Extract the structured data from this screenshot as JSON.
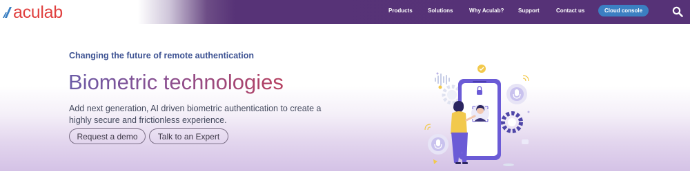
{
  "brand": {
    "name": "aculab",
    "color": "#e0403f"
  },
  "nav": {
    "items": [
      {
        "label": "Products"
      },
      {
        "label": "Solutions"
      },
      {
        "label": "Why Aculab?"
      },
      {
        "label": "Support"
      },
      {
        "label": "Contact us"
      }
    ],
    "cta_label": "Cloud console",
    "search_icon": "search-icon"
  },
  "hero": {
    "eyebrow": "Changing the future of remote authentication",
    "title": "Biometric technologies",
    "description": "Add next generation, AI driven biometric authentication to create a highly secure and frictionless experience.",
    "buttons": [
      {
        "label": "Request a demo"
      },
      {
        "label": "Talk to an Expert"
      }
    ]
  },
  "colors": {
    "header_bg": "#563277",
    "cta_bg": "#3b7fc2",
    "eyebrow": "#3e5393",
    "title_start": "#6a5aa6",
    "title_end": "#b64060"
  }
}
